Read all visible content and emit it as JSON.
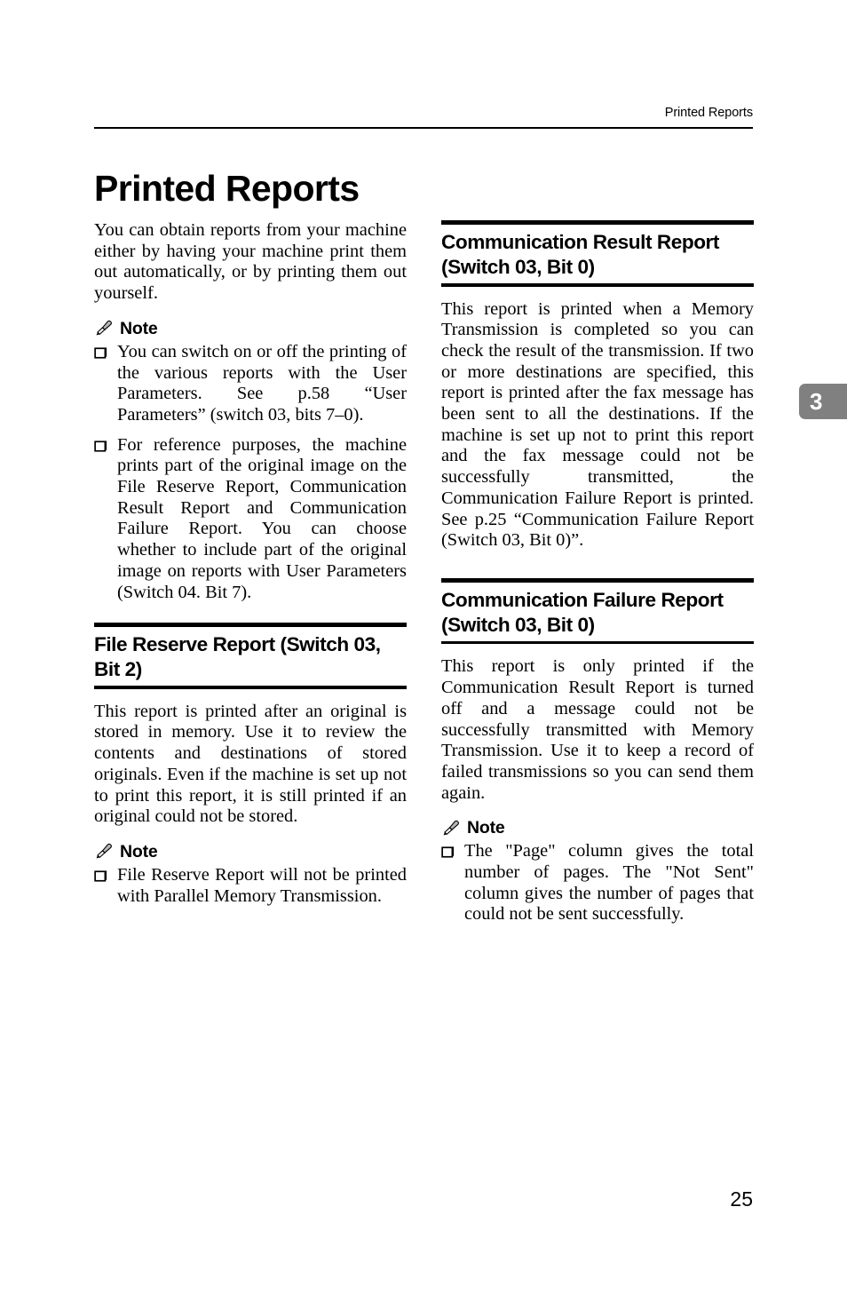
{
  "header": {
    "running_head": "Printed Reports"
  },
  "page_title": "Printed Reports",
  "chapter_tab": {
    "number": "3",
    "color": "#808080",
    "text_color": "#ffffff"
  },
  "page_number": "25",
  "icons": {
    "note": "pencil-icon",
    "bullet": "checkbox-square-icon"
  },
  "left_column": {
    "intro_paragraph": "You can obtain reports from your machine either by having your machine print them out automatically, or by printing them out yourself.",
    "note_label": "Note",
    "notes": [
      "You can switch on or off the printing of the various reports with the User Parameters. See p.58 “User Parameters” (switch 03, bits 7–0).",
      "For reference purposes, the machine prints part of the original image on the File Reserve Report, Communication Result Report and Communication Failure Report. You can choose whether to include part of the original image on reports with User Parameters (Switch 04. Bit 7)."
    ],
    "section": {
      "title": "File Reserve Report (Switch 03, Bit 2)",
      "body": "This report is printed after an original is stored in memory. Use it to review the contents and destinations of stored originals. Even if the machine is set up not to print this report, it is still printed if an original could not be stored.",
      "note_label": "Note",
      "notes": [
        "File Reserve Report will not be printed with Parallel Memory Transmission."
      ]
    }
  },
  "right_column": {
    "section_result": {
      "title": "Communication Result Report (Switch 03, Bit 0)",
      "body": "This report is printed when a Memory Transmission is completed so you can check the result of the transmission. If two or more destinations are specified, this report is printed after the fax message has been sent to all the destinations. If the machine is set up not to print this report and the fax message could not be successfully transmitted, the Communication Failure Report is printed. See p.25 “Communication Failure Report (Switch 03, Bit 0)”."
    },
    "section_failure": {
      "title": "Communication Failure Report (Switch 03, Bit 0)",
      "body": "This report is only printed if the Communication Result Report is turned off and a message could not be successfully transmitted with Memory Transmission. Use it to keep a record of failed transmissions so you can send them again.",
      "note_label": "Note",
      "notes": [
        "The \"Page\" column gives the total number of pages. The \"Not Sent\" column gives the number of pages that could not be sent successfully."
      ]
    }
  }
}
